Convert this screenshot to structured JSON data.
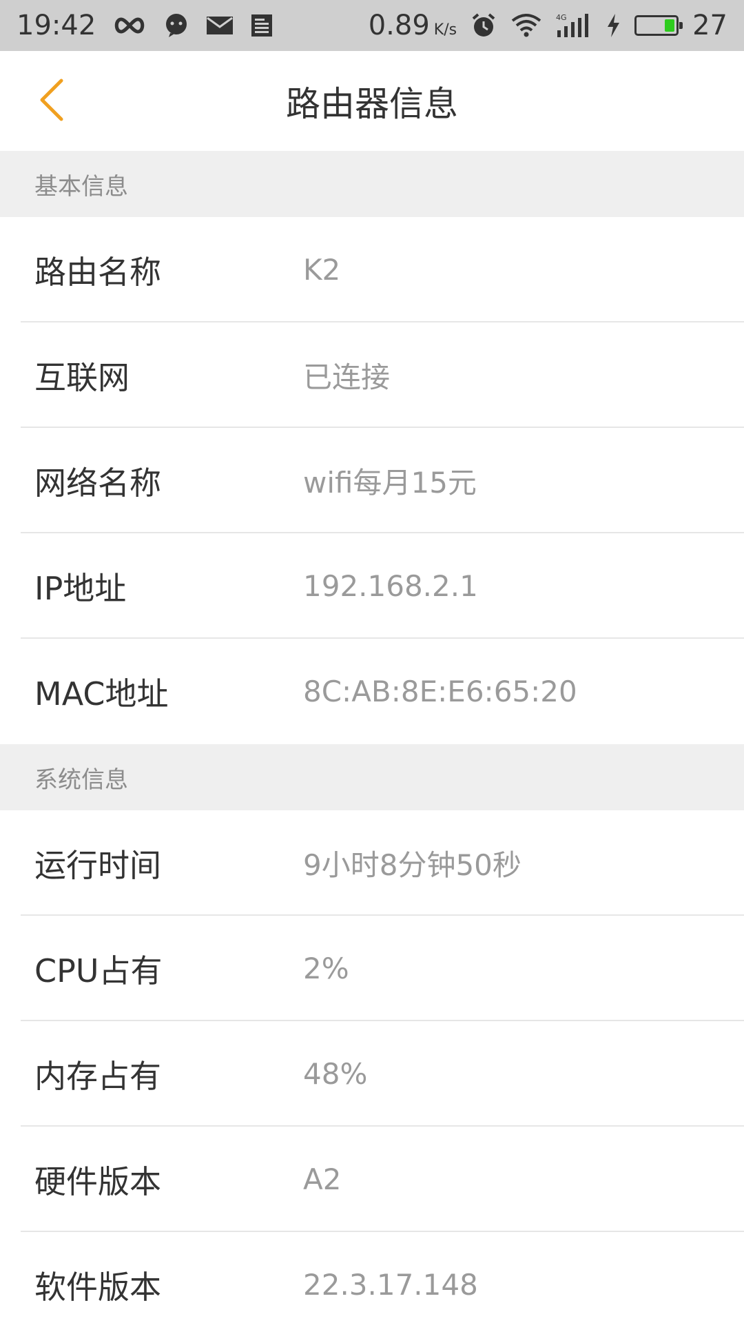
{
  "status_bar": {
    "time": "19:42",
    "speed_value": "0.89",
    "speed_unit": "K/s",
    "battery_percent": "27",
    "battery_level": 0.27,
    "icons": [
      "infinity-icon",
      "wechat-icon",
      "mail-icon",
      "news-icon",
      "alarm-icon",
      "wifi-icon",
      "signal-4g-icon",
      "charging-icon",
      "battery-icon"
    ]
  },
  "header": {
    "title": "路由器信息",
    "back_icon": "chevron-left-icon",
    "accent_color": "#f0a020"
  },
  "sections": [
    {
      "title": "基本信息",
      "rows": [
        {
          "label": "路由名称",
          "value": "K2"
        },
        {
          "label": "互联网",
          "value": "已连接"
        },
        {
          "label": "网络名称",
          "value": "wifi每月15元"
        },
        {
          "label": "IP地址",
          "value": "192.168.2.1"
        },
        {
          "label": "MAC地址",
          "value": "8C:AB:8E:E6:65:20"
        }
      ]
    },
    {
      "title": "系统信息",
      "rows": [
        {
          "label": "运行时间",
          "value": "9小时8分钟50秒"
        },
        {
          "label": "CPU占有",
          "value": "2%"
        },
        {
          "label": "内存占有",
          "value": "48%"
        },
        {
          "label": "硬件版本",
          "value": "A2"
        },
        {
          "label": "软件版本",
          "value": "22.3.17.148"
        }
      ]
    }
  ]
}
